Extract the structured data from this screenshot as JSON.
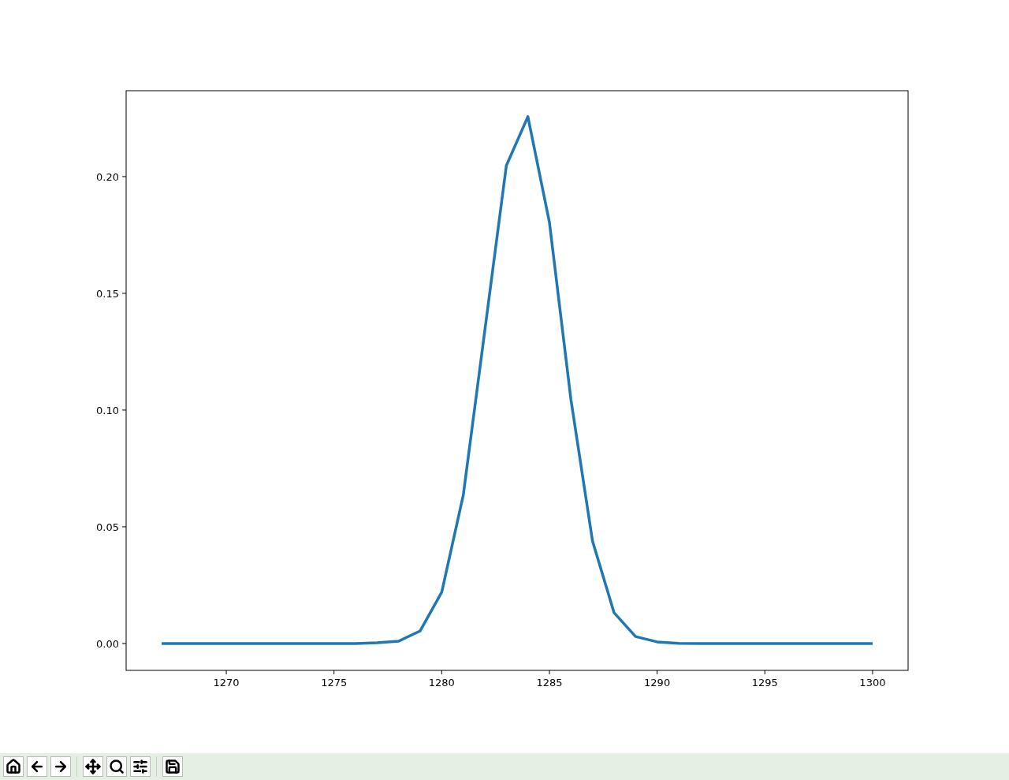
{
  "figure": {
    "chart_data": {
      "type": "line",
      "x": [
        1267,
        1268,
        1269,
        1270,
        1271,
        1272,
        1273,
        1274,
        1275,
        1276,
        1277,
        1278,
        1279,
        1280,
        1281,
        1282,
        1283,
        1284,
        1285,
        1286,
        1287,
        1288,
        1289,
        1290,
        1291,
        1292,
        1293,
        1294,
        1295,
        1296,
        1297,
        1298,
        1299,
        1300
      ],
      "series": [
        {
          "color": "#1f77b4",
          "values": [
            0,
            0,
            0,
            0,
            0,
            0,
            0,
            0,
            0,
            0,
            0.0003,
            0.001,
            0.0054,
            0.022,
            0.0635,
            0.134,
            0.2047,
            0.2257,
            0.1804,
            0.1044,
            0.0439,
            0.0132,
            0.003,
            0.0007,
            0.0001,
            0,
            0,
            0,
            0,
            0,
            0,
            0,
            0,
            0
          ]
        }
      ],
      "xlim": [
        1265.35,
        1301.65
      ],
      "ylim": [
        -0.0115,
        0.2368
      ],
      "xticks": [
        1270,
        1275,
        1280,
        1285,
        1290,
        1295,
        1300
      ],
      "yticks": [
        {
          "value": 0,
          "label": "0.00"
        },
        {
          "value": 0.05,
          "label": "0.05"
        },
        {
          "value": 0.1,
          "label": "0.10"
        },
        {
          "value": 0.15,
          "label": "0.15"
        },
        {
          "value": 0.2,
          "label": "0.20"
        }
      ]
    }
  },
  "toolbar": [
    {
      "kind": "home"
    },
    {
      "kind": "back"
    },
    {
      "kind": "forward"
    },
    {
      "kind": "separator"
    },
    {
      "kind": "pan"
    },
    {
      "kind": "zoom"
    },
    {
      "kind": "configure"
    },
    {
      "kind": "separator"
    },
    {
      "kind": "save"
    }
  ]
}
